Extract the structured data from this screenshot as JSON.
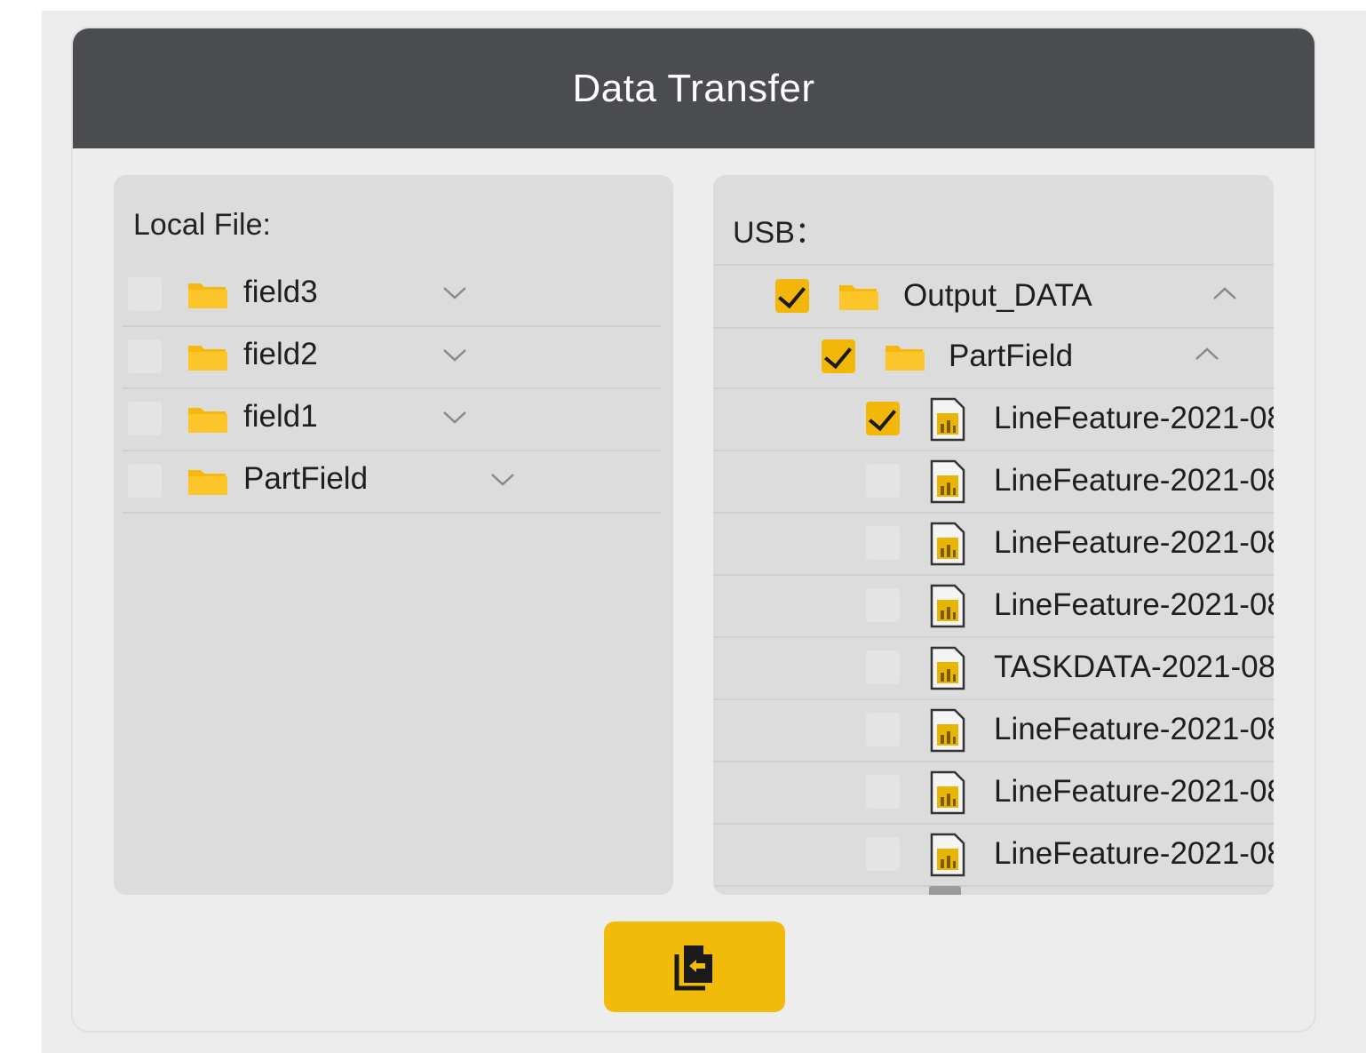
{
  "dialog": {
    "title": "Data Transfer"
  },
  "local": {
    "header": "Local File:",
    "items": [
      {
        "name": "field3",
        "checked": false,
        "icon": "folder-icon",
        "expand": "chevron-down-icon"
      },
      {
        "name": "field2",
        "checked": false,
        "icon": "folder-icon",
        "expand": "chevron-down-icon"
      },
      {
        "name": "field1",
        "checked": false,
        "icon": "folder-icon",
        "expand": "chevron-down-icon"
      },
      {
        "name": "PartField",
        "checked": false,
        "icon": "folder-icon",
        "expand": "chevron-down-icon"
      }
    ]
  },
  "usb": {
    "header": "USB：",
    "items": [
      {
        "name": "Output_DATA",
        "type": "folder",
        "checked": true,
        "expand": "chevron-up-icon"
      },
      {
        "name": "PartField",
        "type": "folder",
        "checked": true,
        "expand": "chevron-up-icon"
      },
      {
        "name": "LineFeature-2021-08",
        "type": "file",
        "checked": true
      },
      {
        "name": "LineFeature-2021-08",
        "type": "file",
        "checked": false
      },
      {
        "name": "LineFeature-2021-08",
        "type": "file",
        "checked": false
      },
      {
        "name": "LineFeature-2021-08",
        "type": "file",
        "checked": false
      },
      {
        "name": "TASKDATA-2021-08",
        "type": "file",
        "checked": false
      },
      {
        "name": "LineFeature-2021-08",
        "type": "file",
        "checked": false
      },
      {
        "name": "LineFeature-2021-08",
        "type": "file",
        "checked": false
      },
      {
        "name": "LineFeature-2021-08",
        "type": "file",
        "checked": false
      }
    ]
  },
  "actions": {
    "transfer_icon": "copy-to-local-icon"
  },
  "colors": {
    "title_bar": "#4b4c50",
    "accent": "#f2b708",
    "panel": "#dcdcdc",
    "background": "#ededed"
  }
}
